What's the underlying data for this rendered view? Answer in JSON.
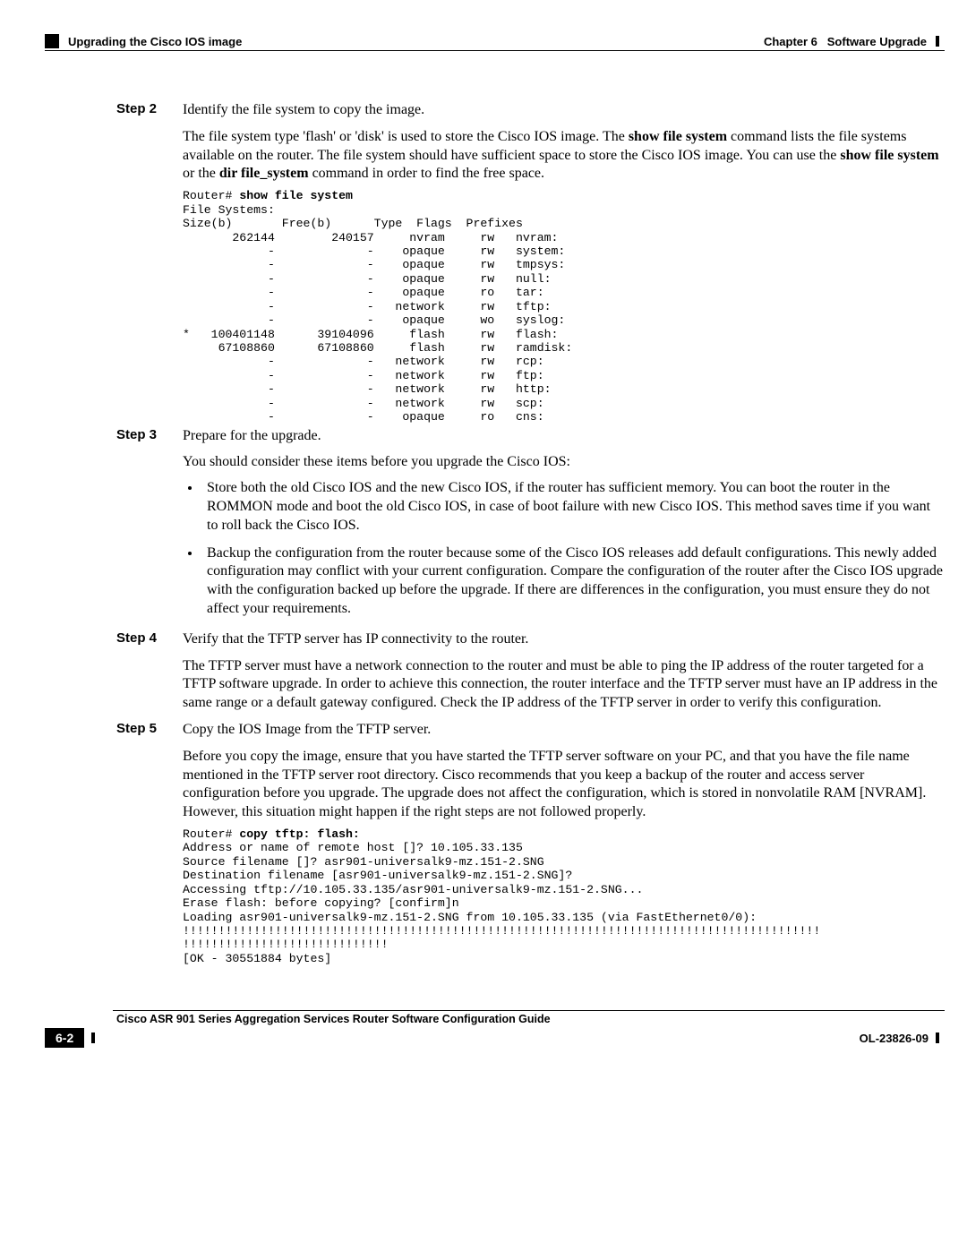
{
  "header": {
    "left": "Upgrading the Cisco IOS image",
    "right_prefix": "Chapter 6",
    "right_title": "Software Upgrade"
  },
  "step2": {
    "label": "Step 2",
    "title": "Identify the file system to copy the image.",
    "p1a": "The file system type 'flash' or 'disk' is used to store the Cisco IOS image. The ",
    "p1b": "show file system",
    "p1c": " command lists the file systems available on the router. The file system should have sufficient space to store the Cisco IOS image. You can use the ",
    "p1d": "show file system",
    "p1e": " or the ",
    "p1f": "dir file_system",
    "p1g": " command in order to find the free space.",
    "term_prefix": "Router# ",
    "term_cmd": "show file system",
    "term_body": "File Systems:\nSize(b)       Free(b)      Type  Flags  Prefixes\n       262144        240157     nvram     rw   nvram:\n            -             -    opaque     rw   system:\n            -             -    opaque     rw   tmpsys:\n            -             -    opaque     rw   null:\n            -             -    opaque     ro   tar:\n            -             -   network     rw   tftp:\n            -             -    opaque     wo   syslog:\n*   100401148      39104096     flash     rw   flash:\n     67108860      67108860     flash     rw   ramdisk:\n            -             -   network     rw   rcp:\n            -             -   network     rw   ftp:\n            -             -   network     rw   http:\n            -             -   network     rw   scp:\n            -             -    opaque     ro   cns:"
  },
  "step3": {
    "label": "Step 3",
    "title": "Prepare for the upgrade.",
    "p1": "You should consider these items before you upgrade the Cisco IOS:",
    "b1": "Store both the old Cisco IOS and the new Cisco IOS, if the router has sufficient memory. You can boot the router in the ROMMON mode and boot the old Cisco IOS, in case of boot failure with new Cisco IOS. This method saves time if you want to roll back the Cisco IOS.",
    "b2": "Backup the configuration from the router because some of the Cisco IOS releases add default configurations. This newly added configuration may conflict with your current configuration. Compare the configuration of the router after the Cisco IOS upgrade with the configuration backed up before the upgrade. If there are differences in the configuration, you must ensure they do not affect your requirements."
  },
  "step4": {
    "label": "Step 4",
    "title": "Verify that the TFTP server has IP connectivity to the router.",
    "p1": "The TFTP server must have a network connection to the router and must be able to ping the IP address of the router targeted for a TFTP software upgrade. In order to achieve this connection, the router interface and the TFTP server must have an IP address in the same range or a default gateway configured. Check the IP address of the TFTP server in order to verify this configuration."
  },
  "step5": {
    "label": "Step 5",
    "title": "Copy the IOS Image from the TFTP server.",
    "p1": "Before you copy the image, ensure that you have started the TFTP server software on your PC, and that you have the file name mentioned in the TFTP server root directory. Cisco recommends that you keep a backup of the router and access server configuration before you upgrade. The upgrade does not affect the configuration, which is stored in nonvolatile RAM [NVRAM]. However, this situation might happen if the right steps are not followed properly.",
    "term_prefix": "Router# ",
    "term_cmd": "copy tftp: flash:",
    "term_body": "Address or name of remote host []? 10.105.33.135\nSource filename []? asr901-universalk9-mz.151-2.SNG\nDestination filename [asr901-universalk9-mz.151-2.SNG]?\nAccessing tftp://10.105.33.135/asr901-universalk9-mz.151-2.SNG...\nErase flash: before copying? [confirm]n\nLoading asr901-universalk9-mz.151-2.SNG from 10.105.33.135 (via FastEthernet0/0): \n!!!!!!!!!!!!!!!!!!!!!!!!!!!!!!!!!!!!!!!!!!!!!!!!!!!!!!!!!!!!!!!!!!!!!!!!!!!!!!!!!!!!!!!!!!\n!!!!!!!!!!!!!!!!!!!!!!!!!!!!!\n[OK - 30551884 bytes]"
  },
  "footer": {
    "title": "Cisco ASR 901 Series Aggregation Services Router Software Configuration Guide",
    "page": "6-2",
    "doc": "OL-23826-09"
  }
}
